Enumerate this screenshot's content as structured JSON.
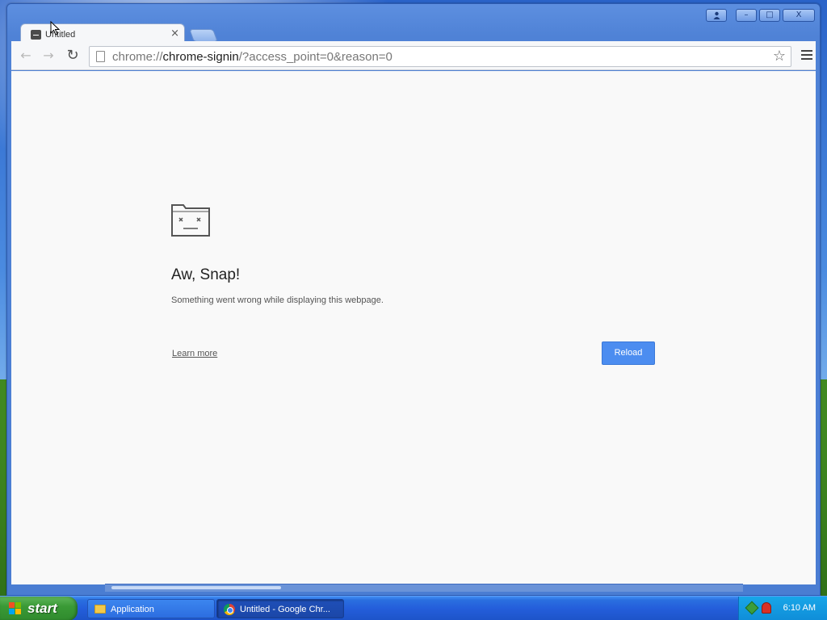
{
  "window": {
    "tab_title": "Untitled",
    "tab_close": "×",
    "controls": {
      "minimize": "–",
      "maximize": "□",
      "close": "X"
    }
  },
  "toolbar": {
    "url_scheme": "chrome://",
    "url_host": "chrome-signin",
    "url_path": "/?access_point=0&reason=0",
    "star": "☆"
  },
  "content": {
    "heading": "Aw, Snap!",
    "message": "Something went wrong while displaying this webpage.",
    "learn_more": "Learn more",
    "reload": "Reload"
  },
  "taskbar": {
    "start": "start",
    "items": [
      {
        "label": "Application",
        "icon": "folder-icon"
      },
      {
        "label": "Untitled - Google Chr...",
        "icon": "chrome-icon"
      }
    ],
    "clock": "6:10 AM"
  },
  "colors": {
    "reload_button": "#4c8df0",
    "taskbar": "#245edb",
    "start_button": "#3a9a36"
  }
}
